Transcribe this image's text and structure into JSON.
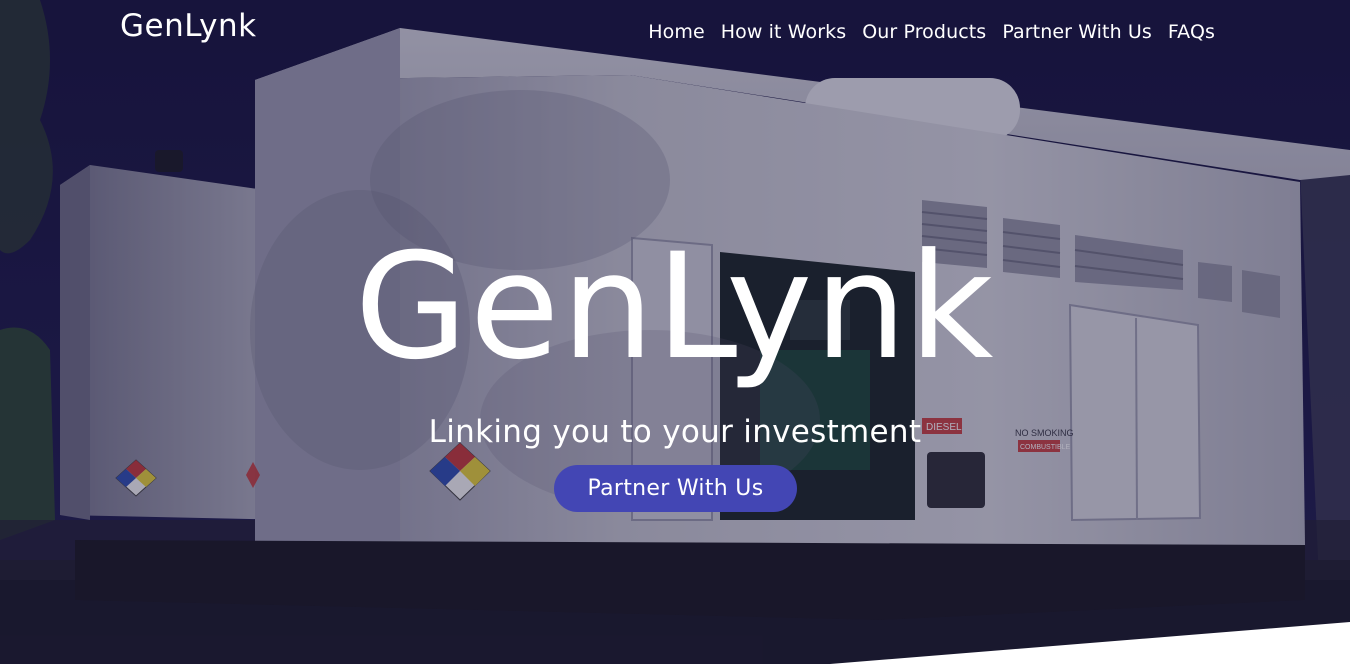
{
  "brand": {
    "name": "GenLynk"
  },
  "nav": {
    "items": [
      {
        "label": "Home"
      },
      {
        "label": "How it Works"
      },
      {
        "label": "Our Products"
      },
      {
        "label": "Partner With Us"
      },
      {
        "label": "FAQs"
      }
    ]
  },
  "hero": {
    "title": "GenLynk",
    "subtitle": "Linking you to your investment",
    "cta_label": "Partner With Us",
    "background_image": "diesel-generator-enclosure-photo",
    "generator_labels": {
      "diesel": "DIESEL",
      "no_smoking": "NO SMOKING",
      "combustible": "COMBUSTIBLE"
    }
  },
  "colors": {
    "sky": "#16143a",
    "overlay": "#18143c",
    "cta_background": "#4346b4",
    "text": "#ffffff"
  }
}
